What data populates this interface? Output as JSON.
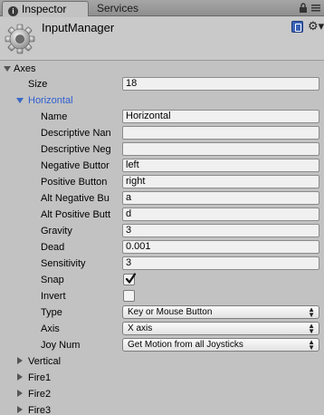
{
  "tabs": {
    "inspector": "Inspector",
    "services": "Services"
  },
  "header": {
    "title": "InputManager"
  },
  "axes": {
    "label": "Axes",
    "size_label": "Size",
    "size_value": "18"
  },
  "horizontal": {
    "label": "Horizontal",
    "fields": [
      {
        "label": "Name",
        "value": "Horizontal"
      },
      {
        "label": "Descriptive Nan",
        "value": ""
      },
      {
        "label": "Descriptive Neg",
        "value": ""
      },
      {
        "label": "Negative Buttor",
        "value": "left"
      },
      {
        "label": "Positive Button",
        "value": "right"
      },
      {
        "label": "Alt Negative Bu",
        "value": "a"
      },
      {
        "label": "Alt Positive Butt",
        "value": "d"
      },
      {
        "label": "Gravity",
        "value": "3"
      },
      {
        "label": "Dead",
        "value": "0.001"
      },
      {
        "label": "Sensitivity",
        "value": "3"
      }
    ],
    "snap_label": "Snap",
    "snap_checked": true,
    "invert_label": "Invert",
    "invert_checked": false,
    "type_label": "Type",
    "type_value": "Key or Mouse Button",
    "axis_label": "Axis",
    "axis_value": "X axis",
    "joy_label": "Joy Num",
    "joy_value": "Get Motion from all Joysticks"
  },
  "collapsed_axes": [
    "Vertical",
    "Fire1",
    "Fire2",
    "Fire3"
  ],
  "colors": {
    "panel_bg": "#c2c2c2",
    "selected_label": "#2f5fd0"
  }
}
